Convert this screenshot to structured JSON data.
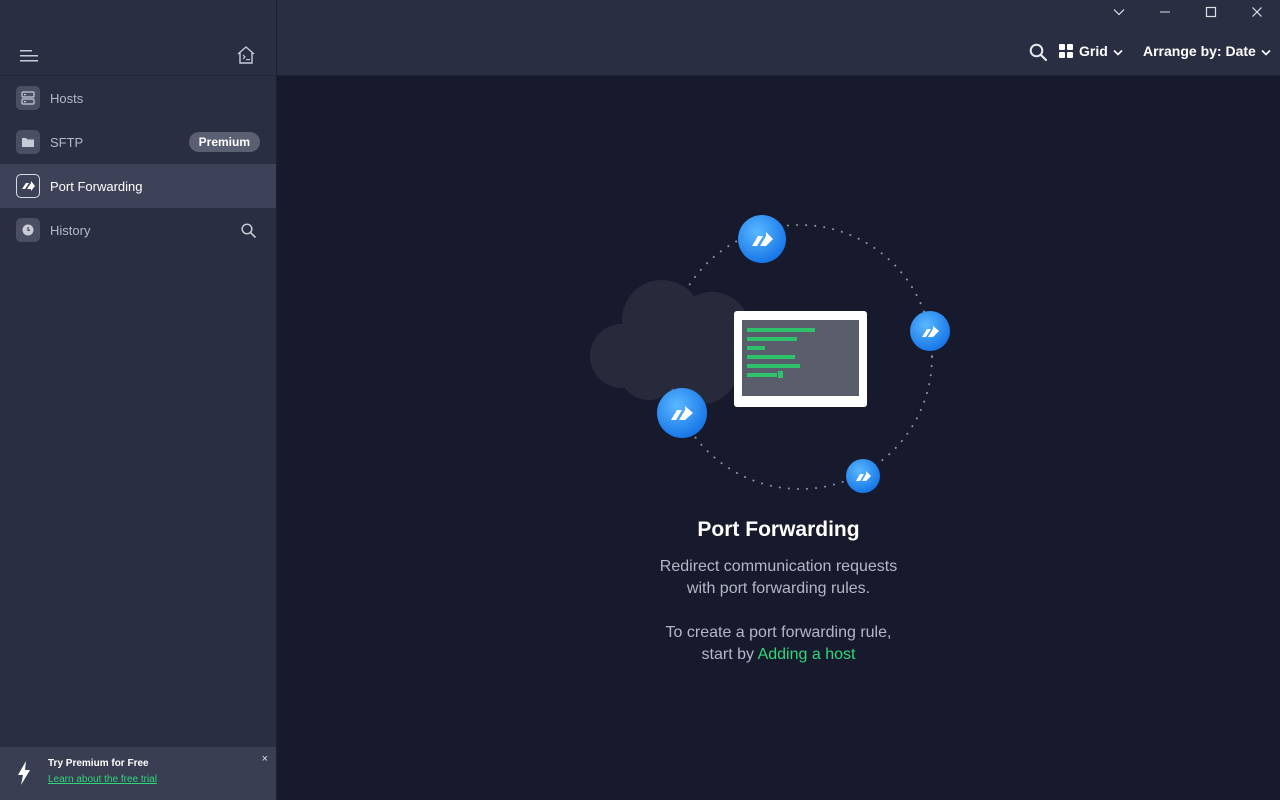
{
  "sidebar": {
    "items": [
      {
        "label": "Hosts"
      },
      {
        "label": "SFTP",
        "badge": "Premium"
      },
      {
        "label": "Port Forwarding"
      },
      {
        "label": "History"
      }
    ],
    "promo": {
      "title": "Try Premium for Free",
      "link": "Learn about the free trial",
      "close": "×"
    }
  },
  "toolbar": {
    "view_label": "Grid",
    "arrange_label": "Arrange by: Date"
  },
  "main": {
    "title": "Port Forwarding",
    "desc_line1": "Redirect communication requests",
    "desc_line2": "with port forwarding rules.",
    "hint_line1": "To create a port forwarding rule,",
    "hint_prefix": "start by ",
    "hint_link": "Adding a host"
  },
  "colors": {
    "accent_green": "#2ed77a",
    "accent_blue": "#1f8ff0",
    "sidebar_bg": "#2a2e43",
    "main_bg": "#161a2c"
  },
  "icons": {
    "menu": "hamburger-icon",
    "home": "home-icon",
    "hosts": "server-icon",
    "sftp": "folder-icon",
    "port_forwarding": "forward-arrow-icon",
    "history": "clock-icon",
    "search": "search-icon",
    "grid": "grid-icon",
    "bolt": "lightning-icon"
  }
}
